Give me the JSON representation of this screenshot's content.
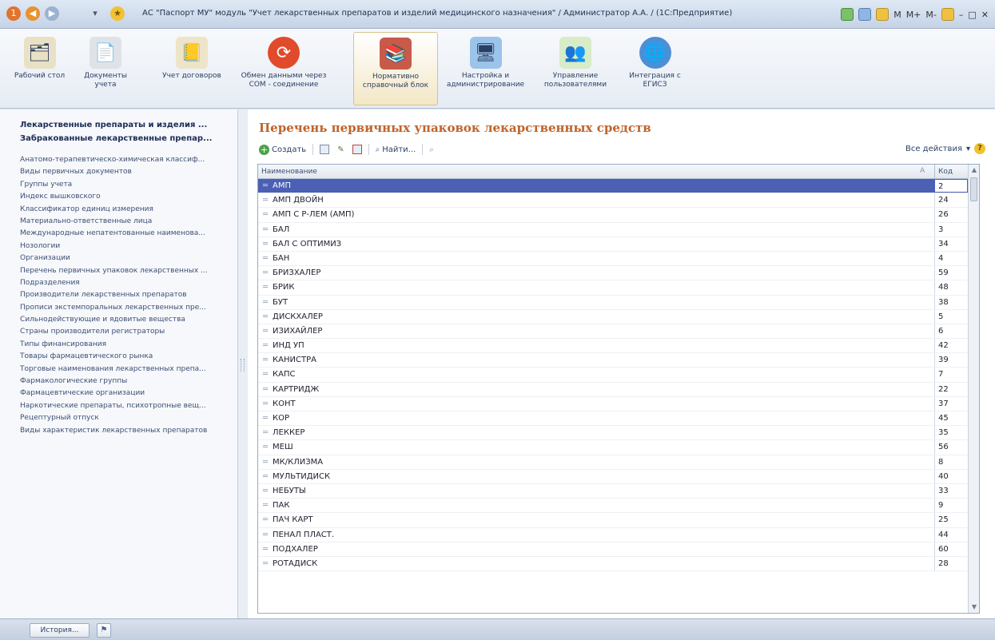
{
  "window": {
    "title": "АС \"Паспорт МУ\" модуль \"Учет лекарственных препаратов и изделий медицинского назначения\" / Администратор А.А. / (1С:Предприятие)",
    "right_labels": [
      "M",
      "M+",
      "M-"
    ]
  },
  "ribbon": {
    "items": [
      {
        "label": "Рабочий стол",
        "icon": "desktop-icon"
      },
      {
        "label": "Документы учета",
        "icon": "documents-icon"
      },
      {
        "label": "Учет договоров",
        "icon": "contracts-icon"
      },
      {
        "label": "Обмен данными через COM - соединение",
        "icon": "exchange-icon"
      },
      {
        "label": "Нормативно справочный блок",
        "icon": "books-icon"
      },
      {
        "label": "Настройка и администрирование",
        "icon": "settings-icon"
      },
      {
        "label": "Управление пользователями",
        "icon": "users-icon"
      },
      {
        "label": "Интеграция с ЕГИСЗ",
        "icon": "globe-icon"
      }
    ]
  },
  "sidebar": {
    "headers": [
      "Лекарственные препараты и изделия ...",
      "Забракованные лекарственные препар..."
    ],
    "items": [
      "Анатомо-терапевтическо-химическая классиф...",
      "Виды первичных документов",
      "Группы учета",
      "Индекс вышковского",
      "Классификатор единиц измерения",
      "Материально-ответственные лица",
      "Международные непатентованные наименова...",
      "Нозологии",
      "Организации",
      "Перечень первичных упаковок лекарственных ...",
      "Подразделения",
      "Производители лекарственных препаратов",
      "Прописи экстемпоральных лекарственных пре...",
      "Сильнодействующие и ядовитые вещества",
      "Страны производители регистраторы",
      "Типы финансирования",
      "Товары фармацевтического рынка",
      "Торговые наименования лекарственных препа...",
      "Фармакологические группы",
      "Фармацевтические организации",
      "Наркотические препараты, психотропные вещ...",
      "Рецептурный отпуск",
      "Виды характеристик лекарственных препаратов"
    ]
  },
  "main": {
    "title": "Перечень первичных упаковок лекарственных средств",
    "toolbar": {
      "create": "Создать",
      "find": "Найти..."
    },
    "all_actions": "Все действия",
    "table": {
      "columns": [
        "Наименование",
        "Код"
      ],
      "rows": [
        {
          "name": "АМП",
          "code": "2"
        },
        {
          "name": "АМП ДВОЙН",
          "code": "24"
        },
        {
          "name": "АМП С Р-ЛЕМ (АМП)",
          "code": "26"
        },
        {
          "name": "БАЛ",
          "code": "3"
        },
        {
          "name": "БАЛ С ОПТИМИЗ",
          "code": "34"
        },
        {
          "name": "БАН",
          "code": "4"
        },
        {
          "name": "БРИЗХАЛЕР",
          "code": "59"
        },
        {
          "name": "БРИК",
          "code": "48"
        },
        {
          "name": "БУТ",
          "code": "38"
        },
        {
          "name": "ДИСКХАЛЕР",
          "code": "5"
        },
        {
          "name": "ИЗИХАЙЛЕР",
          "code": "6"
        },
        {
          "name": "ИНД УП",
          "code": "42"
        },
        {
          "name": "КАНИСТРА",
          "code": "39"
        },
        {
          "name": "КАПС",
          "code": "7"
        },
        {
          "name": "КАРТРИДЖ",
          "code": "22"
        },
        {
          "name": "КОНТ",
          "code": "37"
        },
        {
          "name": "КОР",
          "code": "45"
        },
        {
          "name": "ЛЕККЕР",
          "code": "35"
        },
        {
          "name": "МЕШ",
          "code": "56"
        },
        {
          "name": "МК/КЛИЗМА",
          "code": "8"
        },
        {
          "name": "МУЛЬТИДИСК",
          "code": "40"
        },
        {
          "name": "НЕБУТЫ",
          "code": "33"
        },
        {
          "name": "ПАК",
          "code": "9"
        },
        {
          "name": "ПАЧ КАРТ",
          "code": "25"
        },
        {
          "name": "ПЕНАЛ ПЛАСТ.",
          "code": "44"
        },
        {
          "name": "ПОДХАЛЕР",
          "code": "60"
        },
        {
          "name": "РОТАДИСК",
          "code": "28"
        }
      ]
    }
  },
  "statusbar": {
    "history": "История..."
  }
}
